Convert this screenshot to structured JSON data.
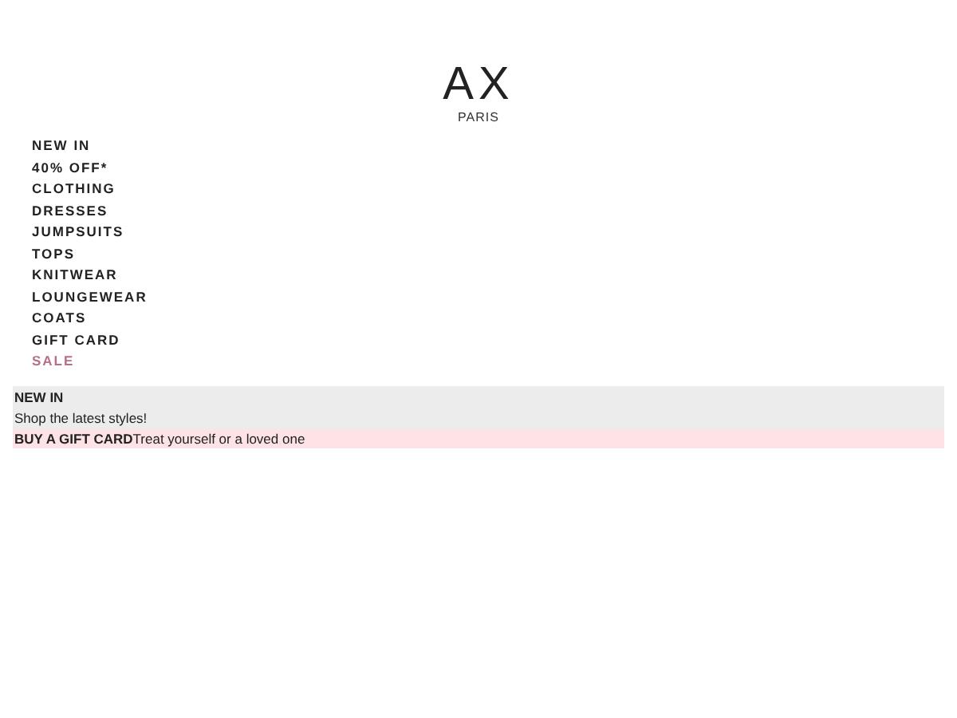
{
  "logo": {
    "brand": "AX",
    "tagline": "PARIS"
  },
  "banners": [
    {
      "kind": "stacked",
      "title": "NEW IN",
      "subtitle": "Shop the latest styles!",
      "color": "#ececec"
    },
    {
      "kind": "inline",
      "title": "BUY A GIFT CARD",
      "subtitle": "Treat yourself or a loved one",
      "color": "#fde3e6"
    }
  ],
  "menu": [
    {
      "label": "NEW IN",
      "kind": "normal"
    },
    {
      "label": "40% OFF*",
      "kind": "normal"
    },
    {
      "label": "CLOTHING",
      "kind": "normal"
    },
    {
      "label": "DRESSES",
      "kind": "normal"
    },
    {
      "label": "JUMPSUITS",
      "kind": "normal"
    },
    {
      "label": "TOPS",
      "kind": "normal"
    },
    {
      "label": "KNITWEAR",
      "kind": "normal"
    },
    {
      "label": "LOUNGEWEAR",
      "kind": "normal"
    },
    {
      "label": "COATS",
      "kind": "normal"
    },
    {
      "label": "GIFT CARD",
      "kind": "normal"
    },
    {
      "label": "SALE",
      "kind": "sale"
    }
  ]
}
